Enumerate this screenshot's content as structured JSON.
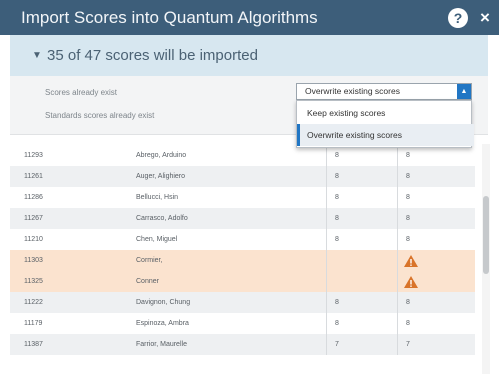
{
  "dialog": {
    "title": "Import Scores into Quantum Algorithms",
    "help_label": "?",
    "close_label": "×"
  },
  "summary": {
    "text": "35 of 47 scores will be imported"
  },
  "options": {
    "scores_exist_label": "Scores already exist",
    "standards_exist_label": "Standards scores already exist",
    "select_value": "Overwrite existing scores",
    "dropdown_options": [
      "Keep existing scores",
      "Overwrite existing scores"
    ],
    "selected_option": "Overwrite existing scores"
  },
  "table": {
    "rows": [
      {
        "id": "11293",
        "name": "Abrego, Arduino",
        "s1": "8",
        "s2": "8",
        "warn": false
      },
      {
        "id": "11261",
        "name": "Auger, Alighiero",
        "s1": "8",
        "s2": "8",
        "warn": false
      },
      {
        "id": "11286",
        "name": "Bellucci, Hsin",
        "s1": "8",
        "s2": "8",
        "warn": false
      },
      {
        "id": "11267",
        "name": "Carrasco, Adolfo",
        "s1": "8",
        "s2": "8",
        "warn": false
      },
      {
        "id": "11210",
        "name": "Chen, Miguel",
        "s1": "8",
        "s2": "8",
        "warn": false
      },
      {
        "id": "11303",
        "name": "Cormier,",
        "s1": "",
        "s2": "",
        "warn": true
      },
      {
        "id": "11325",
        "name": "Conner",
        "s1": "",
        "s2": "",
        "warn": true
      },
      {
        "id": "11222",
        "name": "Davignon, Chung",
        "s1": "8",
        "s2": "8",
        "warn": false
      },
      {
        "id": "11179",
        "name": "Espinoza, Ambra",
        "s1": "8",
        "s2": "8",
        "warn": false
      },
      {
        "id": "11387",
        "name": "Farrior, Maurelle",
        "s1": "7",
        "s2": "7",
        "warn": false
      }
    ]
  },
  "colors": {
    "titlebar": "#3d5e7a",
    "summary_bg": "#d7e7f0",
    "accent": "#2176c4",
    "warning_row": "#fbe3cf",
    "warning_icon": "#d9742a"
  }
}
